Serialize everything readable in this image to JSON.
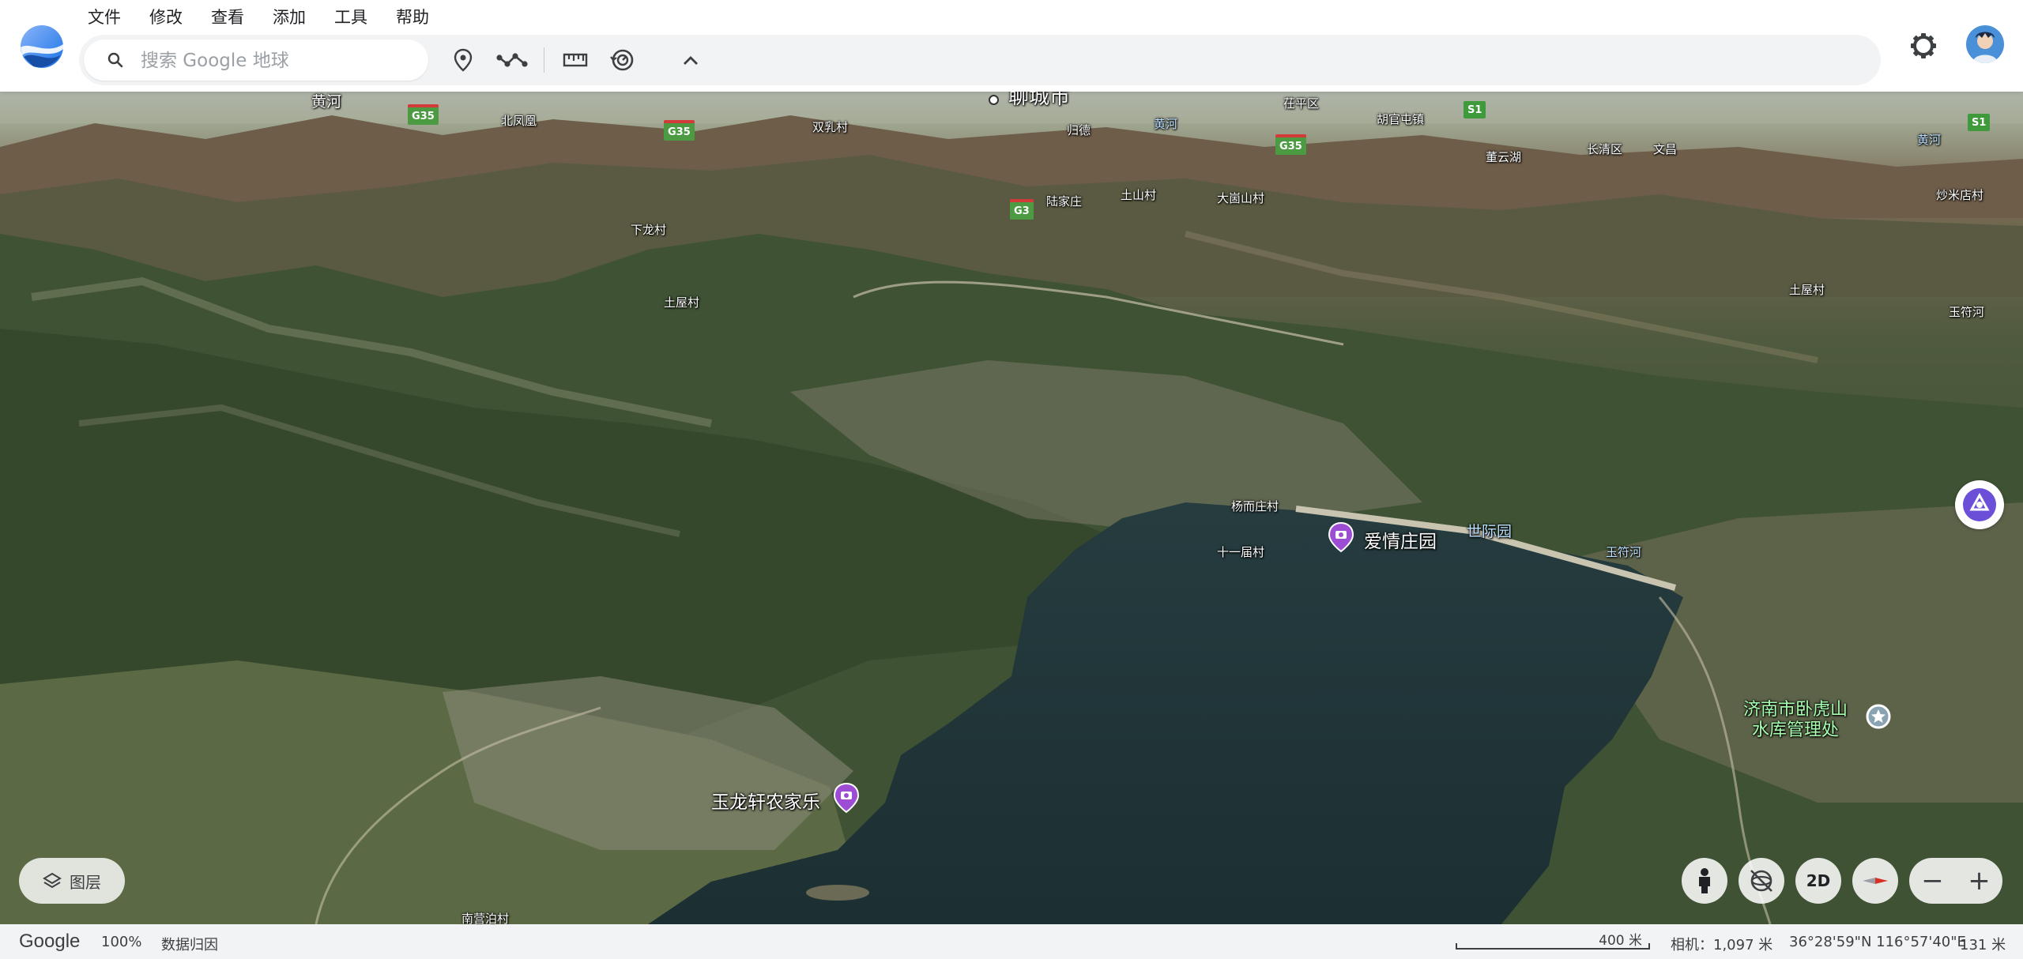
{
  "menu": [
    "文件",
    "修改",
    "查看",
    "添加",
    "工具",
    "帮助"
  ],
  "search": {
    "placeholder": "搜索 Google 地球"
  },
  "toolbar": {
    "placemark_icon": "location-pin-icon",
    "path_icon": "path-icon",
    "measure_icon": "ruler-icon",
    "history_icon": "history-icon",
    "collapse_icon": "chevron-up-icon"
  },
  "map": {
    "city_labels": [
      {
        "text": "聊城市",
        "size": "large"
      },
      {
        "text": "黄河",
        "size": "medium"
      },
      {
        "text": "北凤凰",
        "size": "small"
      },
      {
        "text": "双乳村",
        "size": "small"
      },
      {
        "text": "归德",
        "size": "small"
      },
      {
        "text": "黄河",
        "size": "small"
      },
      {
        "text": "茌平区",
        "size": "small"
      },
      {
        "text": "胡官屯镇",
        "size": "small"
      },
      {
        "text": "董云湖",
        "size": "small"
      },
      {
        "text": "长清区",
        "size": "small"
      },
      {
        "text": "文昌",
        "size": "small"
      },
      {
        "text": "黄河",
        "size": "small"
      },
      {
        "text": "陆家庄",
        "size": "small"
      },
      {
        "text": "土山村",
        "size": "small"
      },
      {
        "text": "大崮山村",
        "size": "small"
      },
      {
        "text": "炒米店村",
        "size": "small"
      },
      {
        "text": "下龙村",
        "size": "small"
      },
      {
        "text": "土屋村",
        "size": "small"
      },
      {
        "text": "土屋村",
        "size": "small"
      },
      {
        "text": "玉符河",
        "size": "small"
      },
      {
        "text": "杨而庄村",
        "size": "small"
      },
      {
        "text": "十一届村",
        "size": "small"
      },
      {
        "text": "玉符河",
        "size": "blue"
      },
      {
        "text": "世际园",
        "size": "blue-medium"
      },
      {
        "text": "南营泊村",
        "size": "small"
      }
    ],
    "road_shields": [
      {
        "text": "G35",
        "type": "g"
      },
      {
        "text": "G35",
        "type": "g"
      },
      {
        "text": "G35",
        "type": "g"
      },
      {
        "text": "G3",
        "type": "g"
      },
      {
        "text": "S1",
        "type": "s"
      },
      {
        "text": "S1",
        "type": "s"
      }
    ],
    "pois": [
      {
        "name": "爱情庄园",
        "icon": "camera-pin-icon",
        "color": "#9c4dd4"
      },
      {
        "name": "玉龙轩农家乐",
        "icon": "camera-pin-icon",
        "color": "#9c4dd4"
      }
    ],
    "green_poi": {
      "line1": "济南市卧虎山",
      "line2": "水库管理处",
      "icon": "star-pin-icon"
    }
  },
  "controls": {
    "layers_label": "图层",
    "layers_icon": "layers-icon",
    "pegman_icon": "pegman-icon",
    "tilt_icon": "tilt-icon",
    "view_2d_label": "2D",
    "compass_icon": "compass-icon",
    "zoom_out_label": "−",
    "zoom_in_label": "+",
    "voyager_icon": "voyager-icon"
  },
  "status": {
    "brand": "Google",
    "zoom": "100%",
    "attribution": "数据归因",
    "scale": "400 米",
    "camera": "相机：1,097 米",
    "coords": "36°28'59\"N 116°57'40\"E",
    "elevation": "131 米"
  },
  "colors": {
    "water": "#1f3336",
    "accent": "#1a73e8",
    "poi_purple": "#9c4dd4",
    "shield_green": "#4c9a42",
    "shield_red": "#d33b3b"
  }
}
